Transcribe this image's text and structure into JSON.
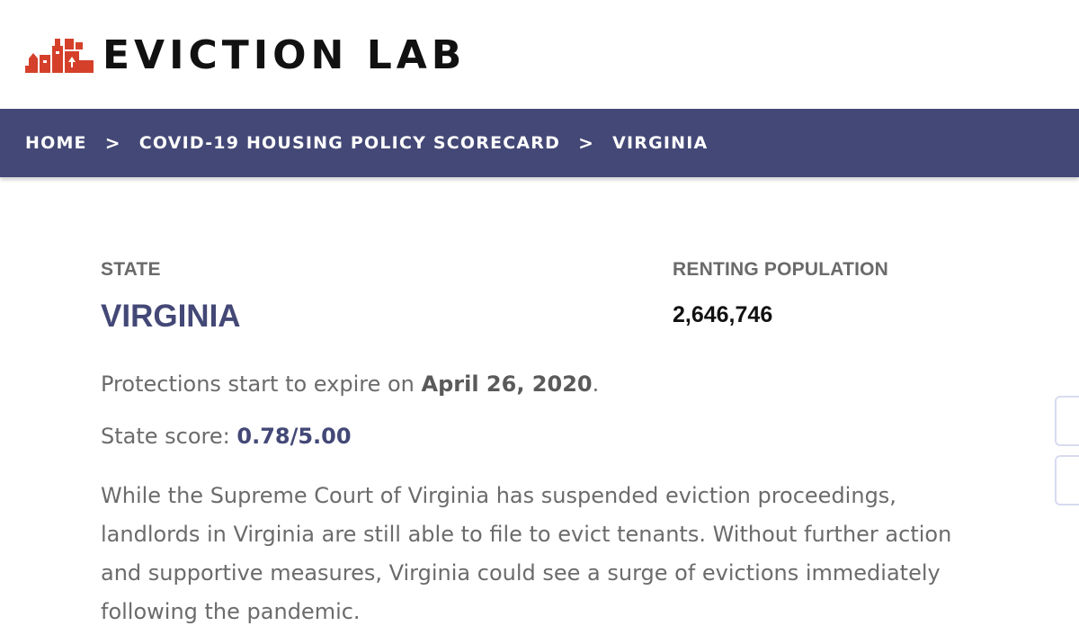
{
  "header": {
    "logo_text": "EVICTION LAB",
    "logo_mark": "houses-icon",
    "brand_color": "#d5402b"
  },
  "nav": {
    "background": "#434876",
    "breadcrumb": [
      {
        "label": "HOME"
      },
      {
        "label": "COVID-19 HOUSING POLICY SCORECARD"
      },
      {
        "label": "VIRGINIA"
      }
    ],
    "separator": ">"
  },
  "summary": {
    "state_label": "STATE",
    "state_name": "VIRGINIA",
    "renting_label": "RENTING POPULATION",
    "renting_value": "2,646,746"
  },
  "details": {
    "expire_prefix": "Protections start to expire on",
    "expire_date": "April 26, 2020",
    "expire_suffix": ".",
    "score_prefix": "State score:",
    "score_value": "0.78/5.00",
    "paragraph": "While the Supreme Court of Virginia has suspended eviction proceedings, landlords in Virginia are still able to file to evict tenants. Without further action and supportive measures, Virginia could see a surge of evictions immediately following the pandemic."
  }
}
